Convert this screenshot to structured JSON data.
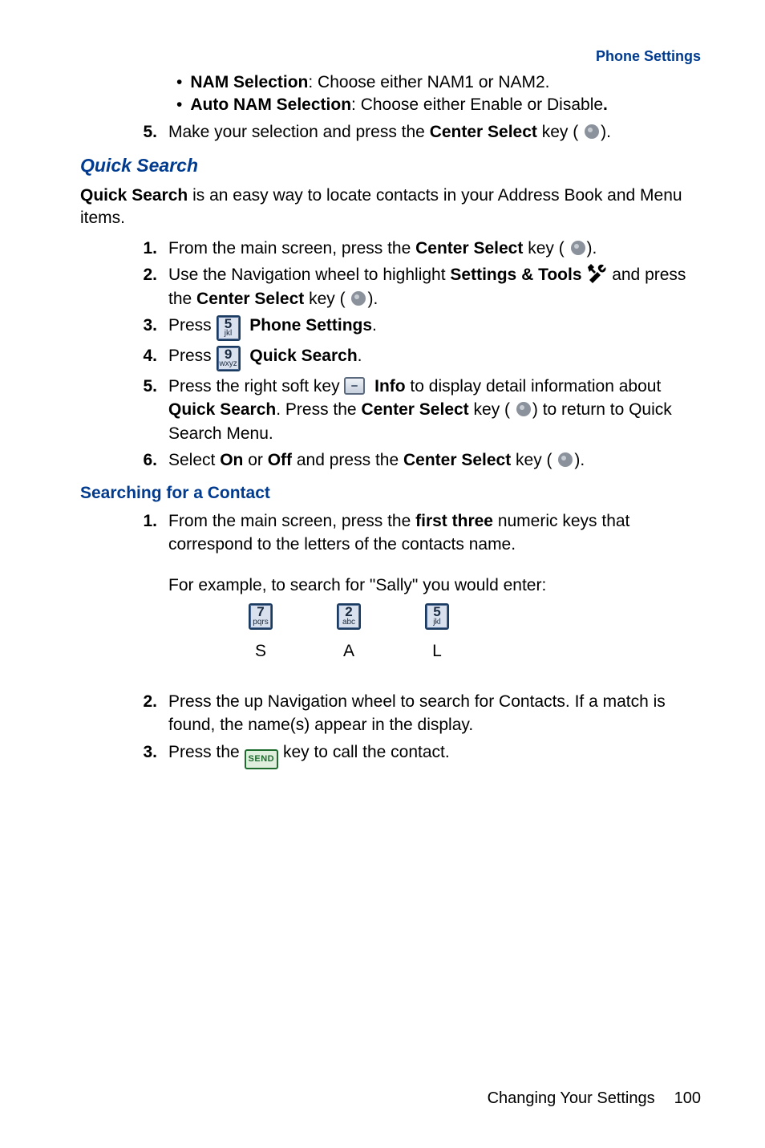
{
  "header": {
    "section_title": "Phone Settings"
  },
  "top_bullets": [
    {
      "label": "NAM Selection",
      "text": ": Choose either NAM1 or NAM2."
    },
    {
      "label": "Auto NAM Selection",
      "text": ": Choose either Enable or Disable"
    }
  ],
  "top_step": {
    "num": "5.",
    "pre": "Make your selection and press the ",
    "bold": "Center Select",
    "post": " key ("
  },
  "quick_search": {
    "title": "Quick Search",
    "intro_bold": "Quick Search",
    "intro_rest": " is an easy way to locate contacts in your Address Book and Menu items.",
    "steps": {
      "s1": {
        "num": "1.",
        "pre": "From the main screen, press the ",
        "bold": "Center Select",
        "post": " key ("
      },
      "s2": {
        "num": "2.",
        "pre": "Use the Navigation wheel to highlight ",
        "bold1": "Settings & Tools",
        "mid": " ",
        "post": " and press the ",
        "bold2": "Center Select",
        "post2": " key ("
      },
      "s3": {
        "num": "3.",
        "pre": "Press ",
        "key_num": "5",
        "key_sub": "jkl",
        "bold": "Phone Settings",
        "post": "."
      },
      "s4": {
        "num": "4.",
        "pre": "Press ",
        "key_num": "9",
        "key_sub": "wxyz",
        "bold": "Quick Search",
        "post": "."
      },
      "s5": {
        "num": "5.",
        "pre": "Press the right soft key ",
        "bold1": "Info",
        "mid": " to display detail information about ",
        "bold2": "Quick Search",
        "post1": ". Press the ",
        "bold3": "Center Select",
        "post2": " key (",
        "post3": ") to return to Quick Search Menu."
      },
      "s6": {
        "num": "6.",
        "pre": "Select ",
        "bold1": "On",
        "mid1": " or ",
        "bold2": "Off",
        "mid2": " and press the ",
        "bold3": "Center Select",
        "post": " key ("
      }
    }
  },
  "searching": {
    "title": "Searching for a Contact",
    "steps": {
      "s1": {
        "num": "1.",
        "pre": "From the main screen, press the ",
        "bold": "first three",
        "post": " numeric keys that correspond to the letters of the contacts name."
      },
      "example_label": "For example, to search for \"Sally\" you would enter:",
      "cols": [
        {
          "key_num": "7",
          "key_sub": "pqrs",
          "letter": "S"
        },
        {
          "key_num": "2",
          "key_sub": "abc",
          "letter": "A"
        },
        {
          "key_num": "5",
          "key_sub": "jkl",
          "letter": "L"
        }
      ],
      "s2": {
        "num": "2.",
        "text": "Press the up Navigation wheel to search for Contacts. If a match is found, the name(s) appear in the display."
      },
      "s3": {
        "num": "3.",
        "pre": "Press the ",
        "send": "SEND",
        "post": " key to call the contact."
      }
    }
  },
  "footer": {
    "chapter": "Changing Your Settings",
    "page": "100"
  }
}
